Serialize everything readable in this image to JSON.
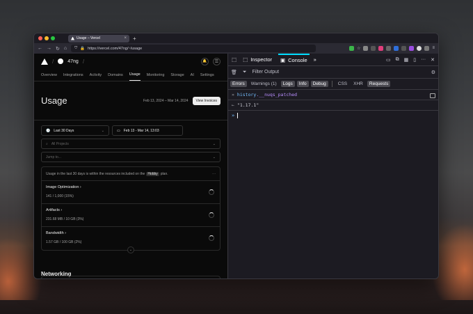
{
  "browser": {
    "tab_title": "Usage – Vercel",
    "tab_close": "×",
    "new_tab": "+",
    "url": "https://vercel.com/47ng/~/usage",
    "nav_back": "←",
    "nav_forward": "→",
    "nav_reload": "↻",
    "nav_home": "⌂",
    "lock": "🔒",
    "tracking": "⛉",
    "bookmark": "☆",
    "ext_ellipsis": "≡"
  },
  "page": {
    "team": "47ng",
    "team_slash": "/",
    "nav_slash": "/",
    "bell_icon": "🔔",
    "menu_icon": "☰",
    "tabs": [
      "Overview",
      "Integrations",
      "Activity",
      "Domains",
      "Usage",
      "Monitoring",
      "Storage",
      "AI",
      "Settings"
    ],
    "active_tab": "Usage",
    "title": "Usage",
    "date_range": "Feb 13, 2024 – Mar 14, 2024",
    "view_invoices": "View Invoices",
    "period_icon": "🕓",
    "period_select": "Last 30 Days",
    "chevron": "⌄",
    "calendar_icon": "▭",
    "date_select": "Feb 13 - Mar 14, 13:03",
    "search_icon": "⌕",
    "projects_placeholder": "All Projects",
    "jump_placeholder": "Jump to...",
    "hint_pre": "Usage in the last 30 days is within the resources included on the",
    "hint_plan": "Hobby",
    "hint_post": "plan.",
    "hint_more": "···",
    "item_chevron": "›",
    "items": [
      {
        "title": "Image Optimization",
        "value": "141 / 1,000 (15%)"
      },
      {
        "title": "Artifacts",
        "value": "231.68 MB / 10 GB (3%)"
      },
      {
        "title": "Bandwidth",
        "value": "1.57 GB / 100 GB (2%)"
      }
    ],
    "expand": "⌄",
    "networking": "Networking"
  },
  "devtools": {
    "pick_icon": "⬚",
    "inspector_icon": "⬚",
    "inspector": "Inspector",
    "console_icon": "▣",
    "console": "Console",
    "more_tools": "»",
    "toolbar_icons": [
      "▭",
      "⧉",
      "▦",
      "▯",
      "···",
      "✕"
    ],
    "trash_icon": "🗑",
    "filter_icon": "⏷",
    "filter_placeholder": "Filter Output",
    "gear_icon": "⚙",
    "chips": [
      {
        "label": "Errors",
        "on": true
      },
      {
        "label": "Warnings (1)",
        "on": false
      },
      {
        "label": "Logs",
        "on": true
      },
      {
        "label": "Info",
        "on": true
      },
      {
        "label": "Debug",
        "on": true
      }
    ],
    "chips2": [
      {
        "label": "CSS",
        "on": false
      },
      {
        "label": "XHR",
        "on": false
      },
      {
        "label": "Requests",
        "on": true
      }
    ],
    "input_prompt": "»",
    "input_obj": "history",
    "input_prop": ".__nuqs_patched",
    "result_prompt": "←",
    "result": "\"1.17.1\"",
    "prompt": "»"
  },
  "colors": {
    "accent": "#00ddff",
    "bg": "#0a0a0a"
  }
}
